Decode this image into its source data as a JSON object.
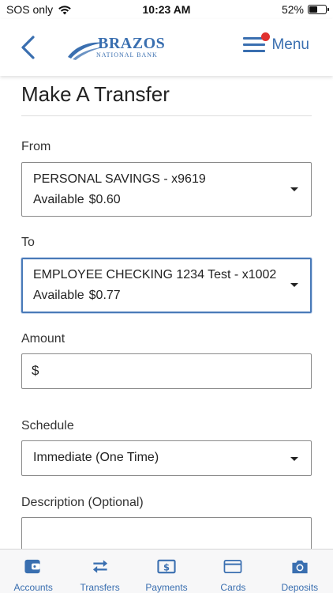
{
  "status_bar": {
    "carrier": "SOS only",
    "time": "10:23 AM",
    "battery_percent": "52%",
    "battery_level": 0.52
  },
  "header": {
    "logo_name": "BRAZOS",
    "logo_sub": "NATIONAL BANK",
    "menu_label": "Menu",
    "has_notification": true
  },
  "page": {
    "title": "Make A Transfer"
  },
  "form": {
    "from": {
      "label": "From",
      "account": "PERSONAL SAVINGS - x9619",
      "available_label": "Available",
      "available_amount": "$0.60"
    },
    "to": {
      "label": "To",
      "account": "EMPLOYEE CHECKING 1234 Test - x1002",
      "available_label": "Available",
      "available_amount": "$0.77"
    },
    "amount": {
      "label": "Amount",
      "currency_symbol": "$",
      "value": ""
    },
    "schedule": {
      "label": "Schedule",
      "selected": "Immediate (One Time)"
    },
    "description": {
      "label": "Description (Optional)",
      "value": ""
    }
  },
  "tabs": [
    {
      "label": "Accounts",
      "icon": "wallet-icon"
    },
    {
      "label": "Transfers",
      "icon": "transfer-arrows-icon"
    },
    {
      "label": "Payments",
      "icon": "dollar-bill-icon"
    },
    {
      "label": "Cards",
      "icon": "credit-card-icon"
    },
    {
      "label": "Deposits",
      "icon": "camera-icon"
    }
  ],
  "colors": {
    "accent": "#3a6fb0",
    "notification": "#e0312f",
    "focus_border": "#4a7ab8"
  }
}
